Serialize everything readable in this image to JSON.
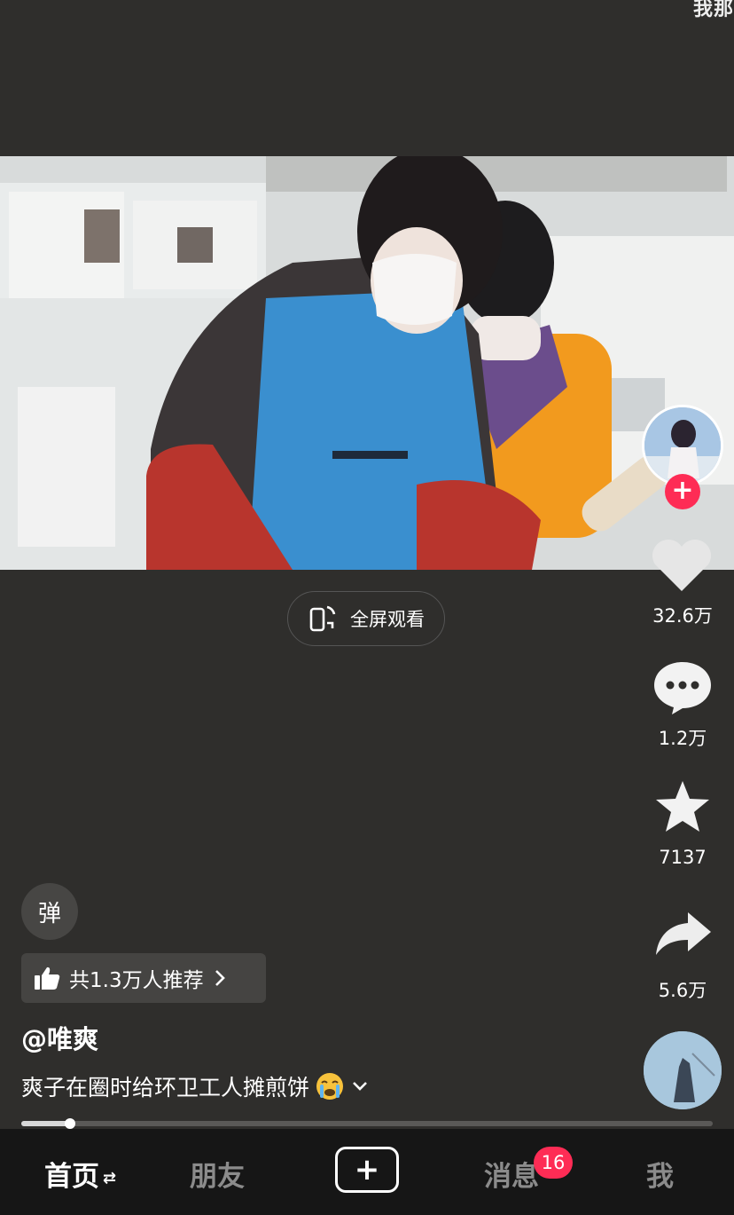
{
  "top_corner_text": "我那",
  "video": {
    "fullscreen_label": "全屏观看"
  },
  "rail": {
    "likes": "32.6万",
    "comments": "1.2万",
    "favorites": "7137",
    "shares": "5.6万"
  },
  "danmu_label": "弹",
  "recommend_label": "共1.3万人推荐",
  "author": "@唯爽",
  "caption": "爽子在圈时给环卫工人摊煎饼",
  "progress": {
    "fraction": 0.07
  },
  "tabs": {
    "home": "首页",
    "friends": "朋友",
    "messages": "消息",
    "messages_badge": "16",
    "me": "我"
  },
  "colors": {
    "accent": "#fe2c55",
    "background": "#2f2e2c",
    "tabbar": "#161616"
  }
}
